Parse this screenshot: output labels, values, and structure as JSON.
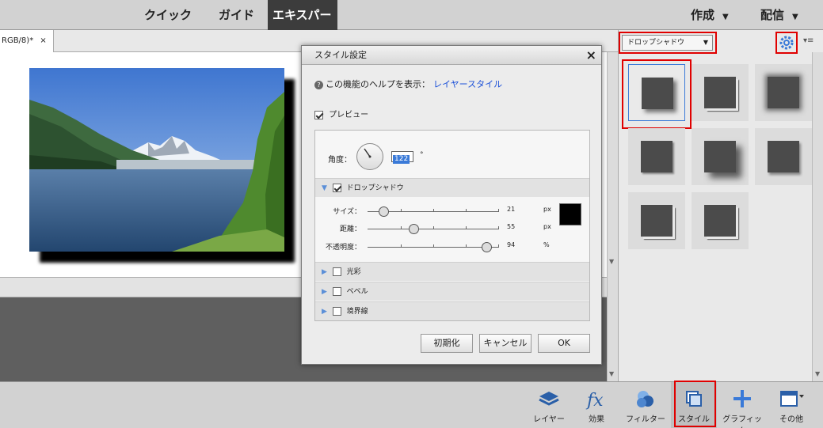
{
  "topbar": {
    "tabs": [
      {
        "label": "クイック"
      },
      {
        "label": "ガイド"
      },
      {
        "label": "エキスパート"
      }
    ],
    "create_label": "作成",
    "share_label": "配信"
  },
  "document": {
    "tab_title": "RGB/8)*",
    "close_glyph": "×"
  },
  "dialog": {
    "title": "スタイル設定",
    "close_glyph": "×",
    "help_text": "この機能のヘルプを表示：",
    "help_link": "レイヤースタイル",
    "preview_label": "プレビュー",
    "angle_label": "角度：",
    "angle_value": "122",
    "angle_unit": "°",
    "drop_shadow_label": "ドロップシャドウ",
    "sliders": [
      {
        "label": "サイズ：",
        "value": "21",
        "unit": "px"
      },
      {
        "label": "距離：",
        "value": "55",
        "unit": "px"
      },
      {
        "label": "不透明度：",
        "value": "94",
        "unit": "%"
      }
    ],
    "shadow_color": "#000000",
    "sections": [
      {
        "label": "光彩"
      },
      {
        "label": "ベベル"
      },
      {
        "label": "境界線"
      }
    ],
    "buttons": {
      "reset": "初期化",
      "cancel": "キャンセル",
      "ok": "OK"
    }
  },
  "styles_panel": {
    "dropdown_value": "ドロップシャドウ",
    "highlight_color": "#e00000",
    "selected_color": "#3a7ad8"
  },
  "bottombar": {
    "items": [
      {
        "label": "レイヤー",
        "icon": "layers-icon"
      },
      {
        "label": "効果",
        "icon": "fx-icon"
      },
      {
        "label": "フィルター",
        "icon": "filter-icon"
      },
      {
        "label": "スタイル",
        "icon": "styles-icon"
      },
      {
        "label": "グラフィック",
        "icon": "graphics-plus-icon"
      },
      {
        "label": "その他",
        "icon": "more-window-icon"
      }
    ]
  }
}
